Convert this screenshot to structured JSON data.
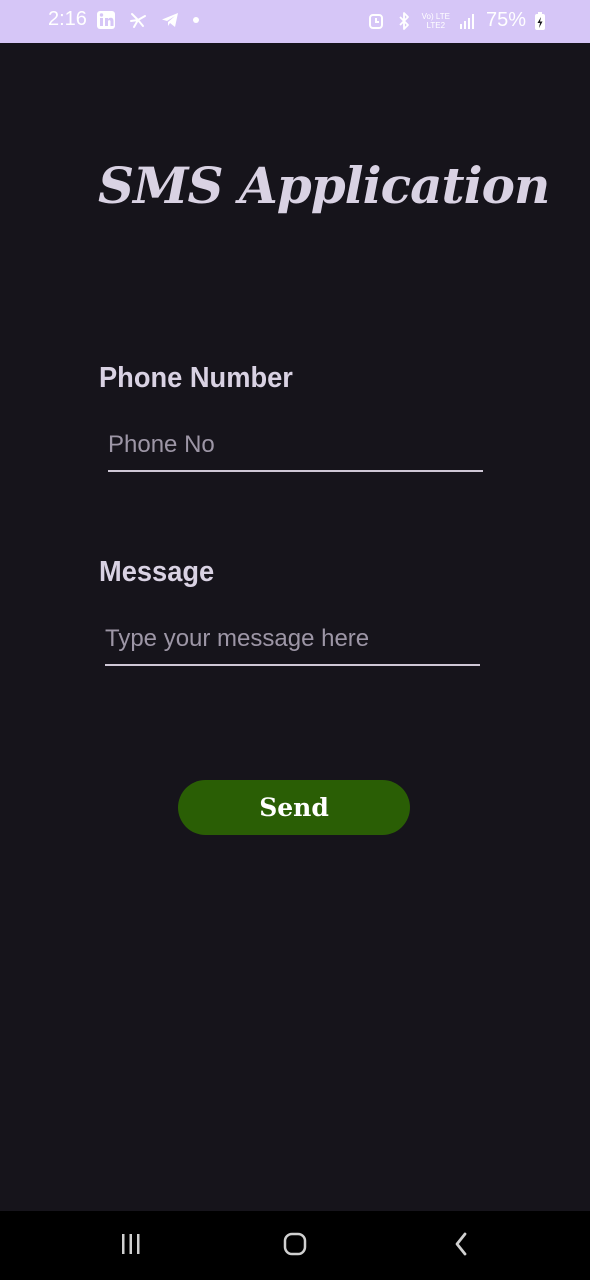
{
  "status_bar": {
    "time": "2:16",
    "battery_percent": "75%",
    "network_label_top": "Vo) LTE",
    "network_label_bottom": "LTE2",
    "left_icons": [
      "linkedin-icon",
      "pinwheel-icon",
      "telegram-icon",
      "dot-icon"
    ],
    "right_icons": [
      "alarm-icon",
      "bluetooth-icon",
      "signal-icon",
      "battery-charging-icon"
    ],
    "background": "#d6c6f7"
  },
  "app": {
    "title": "SMS Application",
    "phone_label": "Phone Number",
    "phone_placeholder": "Phone No",
    "phone_value": "",
    "message_label": "Message",
    "message_placeholder": "Type your message here",
    "message_value": "",
    "send_label": "Send",
    "background": "#16141b",
    "button_color": "#2a5e05"
  },
  "nav_bar": {
    "buttons": [
      "recent-apps-icon",
      "home-icon",
      "back-icon"
    ]
  }
}
